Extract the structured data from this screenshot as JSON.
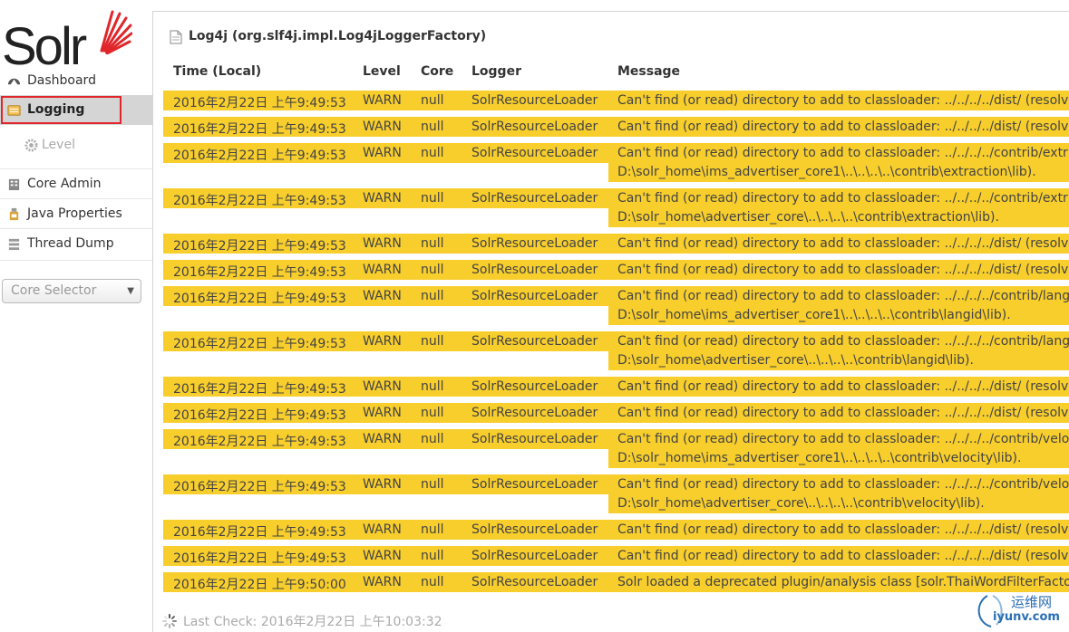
{
  "sidebar": {
    "logo_text": "Solr",
    "items": [
      {
        "id": "dashboard",
        "label": "Dashboard"
      },
      {
        "id": "logging",
        "label": "Logging"
      },
      {
        "id": "level",
        "label": "Level"
      },
      {
        "id": "core-admin",
        "label": "Core Admin"
      },
      {
        "id": "java-properties",
        "label": "Java Properties"
      },
      {
        "id": "thread-dump",
        "label": "Thread Dump"
      }
    ],
    "core_selector_placeholder": "Core Selector"
  },
  "header": {
    "title": "Log4j (org.slf4j.impl.Log4jLoggerFactory)"
  },
  "table": {
    "columns": [
      "Time (Local)",
      "Level",
      "Core",
      "Logger",
      "Message"
    ],
    "rows": [
      {
        "time": "2016年2月22日 上午9:49:53",
        "level": "WARN",
        "core": "null",
        "logger": "SolrResourceLoader",
        "msg": [
          "Can't find (or read) directory to add to classloader: ../../../../dist/ (resolv"
        ]
      },
      {
        "time": "2016年2月22日 上午9:49:53",
        "level": "WARN",
        "core": "null",
        "logger": "SolrResourceLoader",
        "msg": [
          "Can't find (or read) directory to add to classloader: ../../../../dist/ (resolv"
        ]
      },
      {
        "time": "2016年2月22日 上午9:49:53",
        "level": "WARN",
        "core": "null",
        "logger": "SolrResourceLoader",
        "msg": [
          "Can't find (or read) directory to add to classloader: ../../../../contrib/extr",
          "D:\\solr_home\\ims_advertiser_core1\\..\\..\\..\\..\\contrib\\extraction\\lib)."
        ]
      },
      {
        "time": "2016年2月22日 上午9:49:53",
        "level": "WARN",
        "core": "null",
        "logger": "SolrResourceLoader",
        "msg": [
          "Can't find (or read) directory to add to classloader: ../../../../contrib/extr",
          "D:\\solr_home\\advertiser_core\\..\\..\\..\\..\\contrib\\extraction\\lib)."
        ]
      },
      {
        "time": "2016年2月22日 上午9:49:53",
        "level": "WARN",
        "core": "null",
        "logger": "SolrResourceLoader",
        "msg": [
          "Can't find (or read) directory to add to classloader: ../../../../dist/ (resolv"
        ]
      },
      {
        "time": "2016年2月22日 上午9:49:53",
        "level": "WARN",
        "core": "null",
        "logger": "SolrResourceLoader",
        "msg": [
          "Can't find (or read) directory to add to classloader: ../../../../dist/ (resolv"
        ]
      },
      {
        "time": "2016年2月22日 上午9:49:53",
        "level": "WARN",
        "core": "null",
        "logger": "SolrResourceLoader",
        "msg": [
          "Can't find (or read) directory to add to classloader: ../../../../contrib/lang",
          "D:\\solr_home\\ims_advertiser_core1\\..\\..\\..\\..\\contrib\\langid\\lib)."
        ]
      },
      {
        "time": "2016年2月22日 上午9:49:53",
        "level": "WARN",
        "core": "null",
        "logger": "SolrResourceLoader",
        "msg": [
          "Can't find (or read) directory to add to classloader: ../../../../contrib/lang",
          "D:\\solr_home\\advertiser_core\\..\\..\\..\\..\\contrib\\langid\\lib)."
        ]
      },
      {
        "time": "2016年2月22日 上午9:49:53",
        "level": "WARN",
        "core": "null",
        "logger": "SolrResourceLoader",
        "msg": [
          "Can't find (or read) directory to add to classloader: ../../../../dist/ (resolv"
        ]
      },
      {
        "time": "2016年2月22日 上午9:49:53",
        "level": "WARN",
        "core": "null",
        "logger": "SolrResourceLoader",
        "msg": [
          "Can't find (or read) directory to add to classloader: ../../../../dist/ (resolv"
        ]
      },
      {
        "time": "2016年2月22日 上午9:49:53",
        "level": "WARN",
        "core": "null",
        "logger": "SolrResourceLoader",
        "msg": [
          "Can't find (or read) directory to add to classloader: ../../../../contrib/velo",
          "D:\\solr_home\\ims_advertiser_core1\\..\\..\\..\\..\\contrib\\velocity\\lib)."
        ]
      },
      {
        "time": "2016年2月22日 上午9:49:53",
        "level": "WARN",
        "core": "null",
        "logger": "SolrResourceLoader",
        "msg": [
          "Can't find (or read) directory to add to classloader: ../../../../contrib/velo",
          "D:\\solr_home\\advertiser_core\\..\\..\\..\\..\\contrib\\velocity\\lib)."
        ]
      },
      {
        "time": "2016年2月22日 上午9:49:53",
        "level": "WARN",
        "core": "null",
        "logger": "SolrResourceLoader",
        "msg": [
          "Can't find (or read) directory to add to classloader: ../../../../dist/ (resolv"
        ]
      },
      {
        "time": "2016年2月22日 上午9:49:53",
        "level": "WARN",
        "core": "null",
        "logger": "SolrResourceLoader",
        "msg": [
          "Can't find (or read) directory to add to classloader: ../../../../dist/ (resolv"
        ]
      },
      {
        "time": "2016年2月22日 上午9:50:00",
        "level": "WARN",
        "core": "null",
        "logger": "SolrResourceLoader",
        "msg": [
          "Solr loaded a deprecated plugin/analysis class [solr.ThaiWordFilterFacto"
        ]
      }
    ]
  },
  "footer": {
    "last_check": "Last Check: 2016年2月22日 上午10:03:32"
  },
  "watermark": {
    "line1": "运维网",
    "line2": "iyunv.com"
  },
  "colors": {
    "warn_row": "#f8ce2c",
    "selected_nav": "#d5d5d5",
    "highlight_border": "#e0262b",
    "logo_sun": "#e0262b"
  }
}
